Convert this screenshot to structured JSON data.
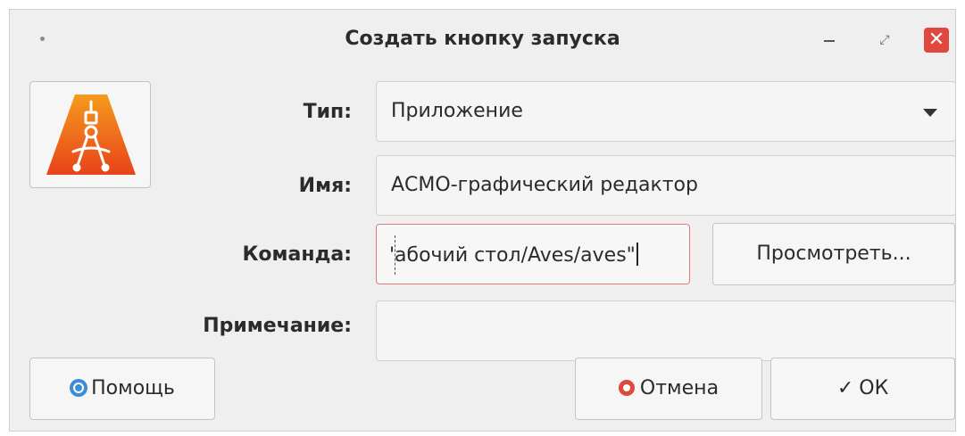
{
  "window": {
    "title": "Создать кнопку запуска",
    "close_glyph": "✕",
    "maximize_glyph": "⤢"
  },
  "form": {
    "type_label": "Тип:",
    "type_value": "Приложение",
    "name_label": "Имя:",
    "name_value": "АСМО-графический редактор",
    "command_label": "Команда:",
    "command_value": "'абочий стол/Aves/aves\"",
    "note_label": "Примечание:",
    "note_value": ""
  },
  "buttons": {
    "browse": "Просмотреть...",
    "help": "Помощь",
    "cancel": "Отмена",
    "ok": "ОК",
    "ok_glyph": "✓"
  },
  "icons": {
    "app_icon": "compass-drafting-icon",
    "help_icon": "lifebuoy-icon",
    "cancel_icon": "stop-circle-icon",
    "ok_icon": "checkmark-icon"
  },
  "colors": {
    "close_button": "#e0473e",
    "app_icon_gradient_top": "#f59a1d",
    "app_icon_gradient_bottom": "#e8431a",
    "command_border": "#e07a7a"
  }
}
